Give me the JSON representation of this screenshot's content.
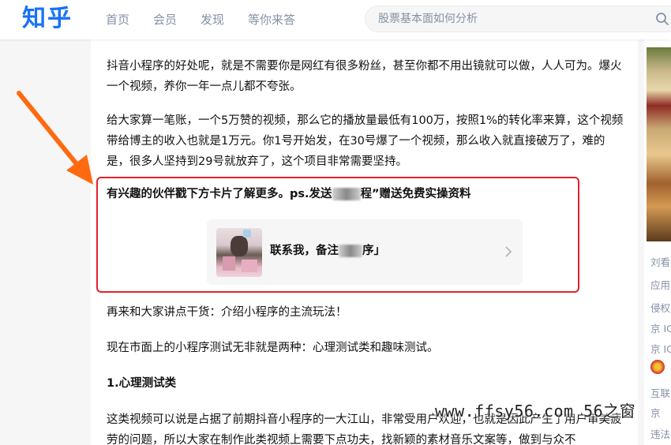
{
  "header": {
    "logo": "知乎",
    "nav": [
      "首页",
      "会员",
      "发现",
      "等你来答"
    ],
    "search_placeholder": "股票基本面如何分析"
  },
  "article": {
    "paragraphs": [
      "抖音小程序的好处呢，就是不需要你是网红有很多粉丝，甚至你都不用出镜就可以做，人人可为。爆火一个视频，养你一年一点儿都不夸张。",
      "给大家算一笔账，一个5万赞的视频，那么它的播放量最低有100万，按照1%的转化率来算，这个视频带给博主的收入也就是1万元。你1号开始发，在30号爆了一个视频，那么收入就直接破万了，难的是，很多人坚持到29号就放弃了，这个项目非常需要坚持。"
    ],
    "cta_part1": "有兴趣的伙伴戳下方卡片了解更多。ps.发送",
    "cta_part2": "程”赠送免费实操资料",
    "card": {
      "text_part1": "联系我，备注",
      "text_part2": "序」"
    },
    "para_after_1": "再来和大家讲点干货：介绍小程序的主流玩法！",
    "para_after_2": "现在市面上的小程序测试无非就是两种：心理测试类和趣味测试。",
    "heading": "1.心理测试类",
    "para_after_3": "这类视频可以说是占据了前期抖音小程序的一大江山，非常受用户欢迎，也就是因此产生了用户审美疲劳的问题，所以大家在制作此类视频上需要下点功夫，找新颖的素材音乐文案等，做到与众不"
  },
  "sidebar": {
    "items": [
      "刘看",
      "应用",
      "侵权",
      "京 IC",
      "京 IC",
      "互联",
      "京",
      "违法"
    ]
  },
  "watermark": "www.ffsy56.com 56之窗"
}
